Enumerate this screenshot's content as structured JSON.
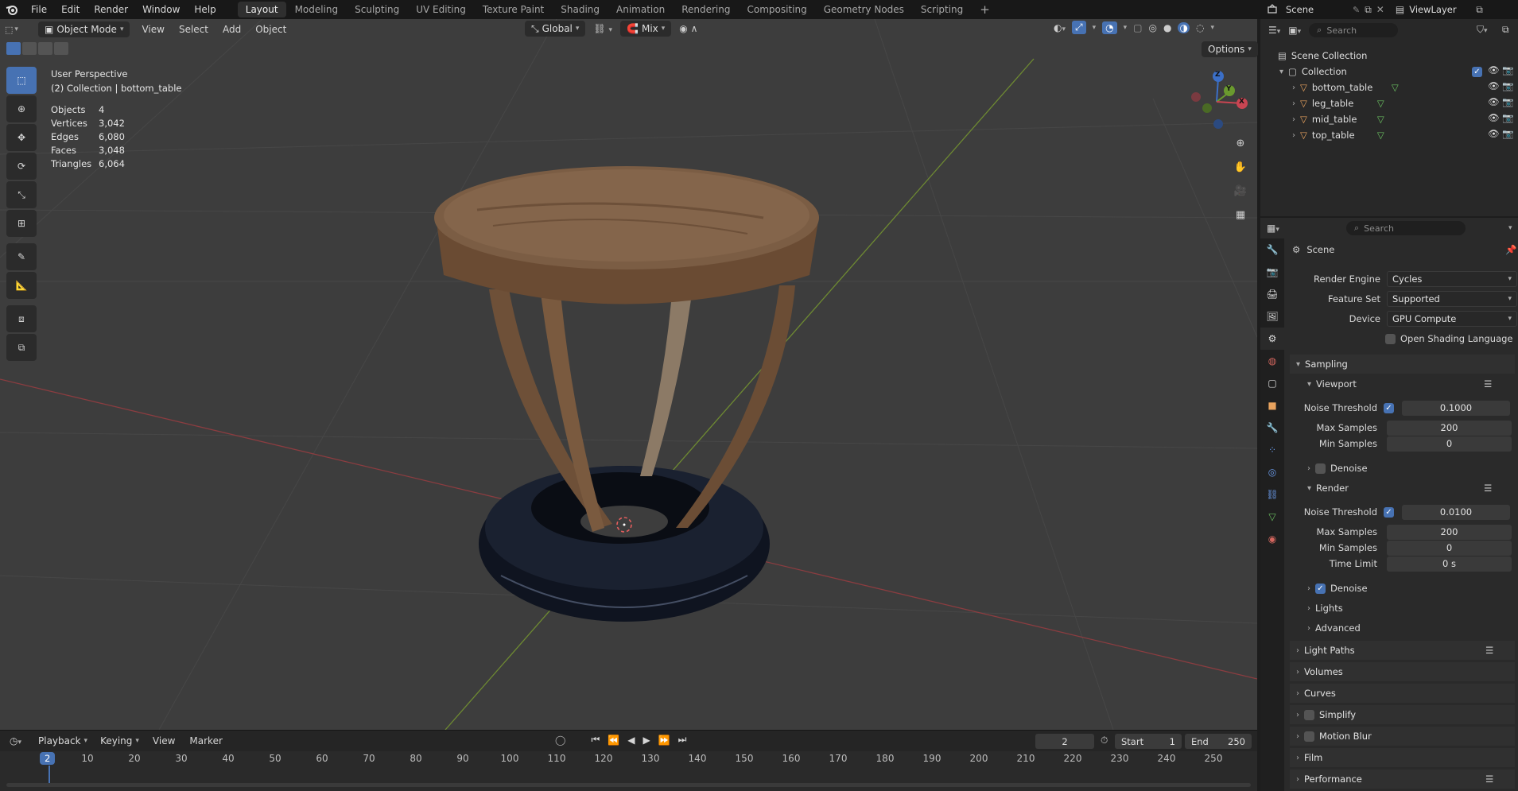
{
  "topbar": {
    "menus": [
      "File",
      "Edit",
      "Render",
      "Window",
      "Help"
    ],
    "workspaces": [
      "Layout",
      "Modeling",
      "Sculpting",
      "UV Editing",
      "Texture Paint",
      "Shading",
      "Animation",
      "Rendering",
      "Compositing",
      "Geometry Nodes",
      "Scripting"
    ],
    "active_workspace": "Layout",
    "add_tab": "+",
    "scene_label": "Scene",
    "viewlayer_label": "ViewLayer"
  },
  "viewport_header": {
    "mode": "Object Mode",
    "menus": [
      "View",
      "Select",
      "Add",
      "Object"
    ],
    "transform_orientation": "Global",
    "snap_mix": "Mix",
    "options": "Options"
  },
  "viewport_overlay": {
    "perspective": "User Perspective",
    "collection_line": "(2) Collection | bottom_table",
    "stats": [
      {
        "label": "Objects",
        "value": "4"
      },
      {
        "label": "Vertices",
        "value": "3,042"
      },
      {
        "label": "Edges",
        "value": "6,080"
      },
      {
        "label": "Faces",
        "value": "3,048"
      },
      {
        "label": "Triangles",
        "value": "6,064"
      }
    ],
    "gizmo": {
      "x": "X",
      "y": "Y",
      "z": "Z"
    }
  },
  "timeline": {
    "menus": [
      "Playback",
      "Keying",
      "View",
      "Marker"
    ],
    "current_frame": "2",
    "start_label": "Start",
    "start_value": "1",
    "end_label": "End",
    "end_value": "250",
    "ruler_current": "2",
    "ruler_ticks": [
      "10",
      "20",
      "30",
      "40",
      "50",
      "60",
      "70",
      "80",
      "90",
      "100",
      "110",
      "120",
      "130",
      "140",
      "150",
      "160",
      "170",
      "180",
      "190",
      "200",
      "210",
      "220",
      "230",
      "240",
      "250"
    ]
  },
  "outliner": {
    "search_placeholder": "Search",
    "scene_collection": "Scene Collection",
    "collection": "Collection",
    "objects": [
      "bottom_table",
      "leg_table",
      "mid_table",
      "top_table"
    ]
  },
  "properties": {
    "search_placeholder": "Search",
    "context": "Scene",
    "render_engine_label": "Render Engine",
    "render_engine_value": "Cycles",
    "feature_set_label": "Feature Set",
    "feature_set_value": "Supported",
    "device_label": "Device",
    "device_value": "GPU Compute",
    "osl_label": "Open Shading Language",
    "sampling": "Sampling",
    "viewport": "Viewport",
    "vp_noise_label": "Noise Threshold",
    "vp_noise_value": "0.1000",
    "vp_max_label": "Max Samples",
    "vp_max_value": "200",
    "vp_min_label": "Min Samples",
    "vp_min_value": "0",
    "vp_denoise": "Denoise",
    "render": "Render",
    "r_noise_label": "Noise Threshold",
    "r_noise_value": "0.0100",
    "r_max_label": "Max Samples",
    "r_max_value": "200",
    "r_min_label": "Min Samples",
    "r_min_value": "0",
    "r_time_label": "Time Limit",
    "r_time_value": "0 s",
    "r_denoise": "Denoise",
    "lights": "Lights",
    "advanced": "Advanced",
    "panels": [
      "Light Paths",
      "Volumes",
      "Curves",
      "Simplify",
      "Motion Blur",
      "Film",
      "Performance"
    ]
  }
}
